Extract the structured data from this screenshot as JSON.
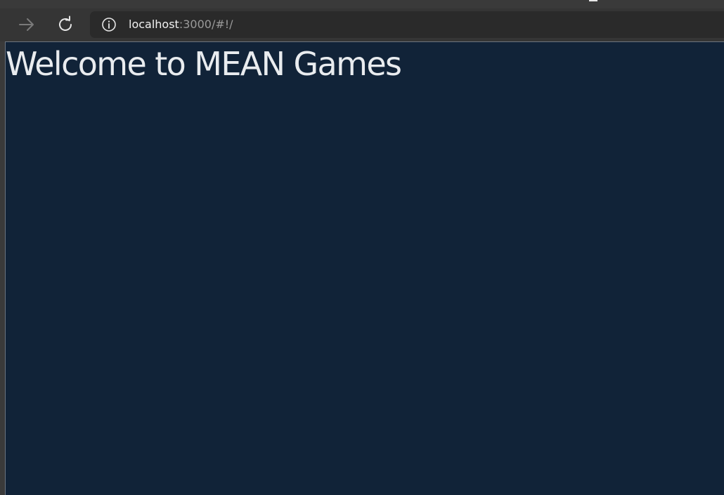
{
  "browser": {
    "nav": {
      "forward_icon": "arrow-right-icon",
      "reload_icon": "reload-icon"
    },
    "address_bar": {
      "info_icon": "info-icon",
      "url_host": "localhost",
      "url_rest": ":3000/#!/"
    }
  },
  "page": {
    "heading": "Welcome to MEAN Games",
    "background_color": "#112338",
    "text_color": "#e9ecef"
  }
}
